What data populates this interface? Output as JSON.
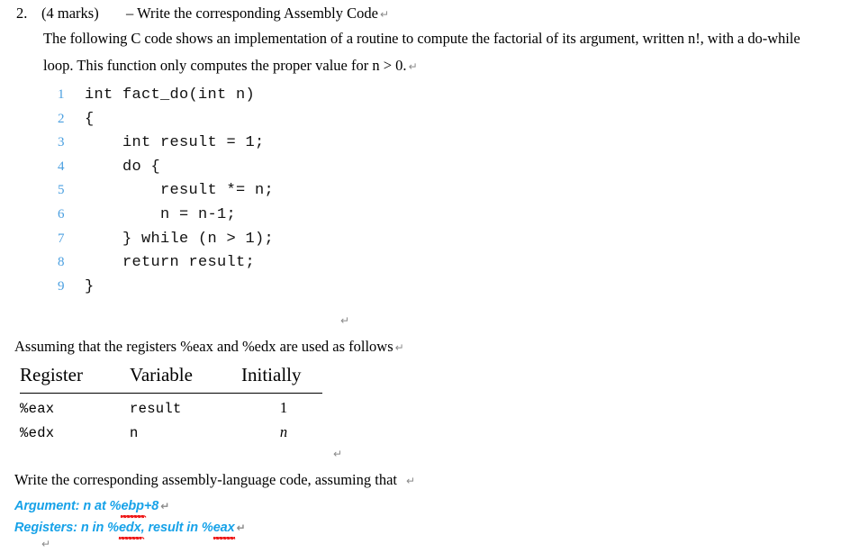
{
  "question": {
    "number": "2.",
    "marks": "(4 marks)",
    "title": "– Write the corresponding Assembly Code",
    "pilcrow": "↵"
  },
  "intro": {
    "line1": "The following C code shows an implementation of a routine to compute the factorial of its argument, written n!, with a do-while",
    "line2": "loop. This function only computes the proper value for n > 0.",
    "pilcrow": "↵"
  },
  "code": {
    "language": "C",
    "lineno_color": "#4a9fe0",
    "pilcrow": "↵",
    "lines": [
      {
        "no": "1",
        "text": "int fact_do(int n)"
      },
      {
        "no": "2",
        "text": "{"
      },
      {
        "no": "3",
        "text": "    int result = 1;"
      },
      {
        "no": "4",
        "text": "    do {"
      },
      {
        "no": "5",
        "text": "        result *= n;"
      },
      {
        "no": "6",
        "text": "        n = n-1;"
      },
      {
        "no": "7",
        "text": "    } while (n > 1);"
      },
      {
        "no": "8",
        "text": "    return result;"
      },
      {
        "no": "9",
        "text": "}"
      }
    ]
  },
  "assuming": {
    "text": "Assuming that the registers %eax and %edx are used as follows",
    "pilcrow": "↵"
  },
  "register_table": {
    "headers": [
      "Register",
      "Variable",
      "Initially"
    ],
    "rows": [
      {
        "register": "%eax",
        "variable": "result",
        "initially": "1"
      },
      {
        "register": "%edx",
        "variable": "n",
        "initially": "n"
      }
    ],
    "pilcrow": "↵"
  },
  "write_instruction": {
    "text": "Write the corresponding assembly-language code, assuming that",
    "pilcrow": "↵"
  },
  "annotations": {
    "color": "#17a2e8",
    "argument": {
      "prefix": "Argument: n at %",
      "word": "ebp",
      "suffix": "+8",
      "pilcrow": "↵"
    },
    "registers": {
      "prefix": "Registers: n in %",
      "word1": "edx",
      "middle": ", result in %",
      "word2": "eax",
      "pilcrow": "↵"
    }
  },
  "bottom": {
    "pilcrow": "↵"
  }
}
